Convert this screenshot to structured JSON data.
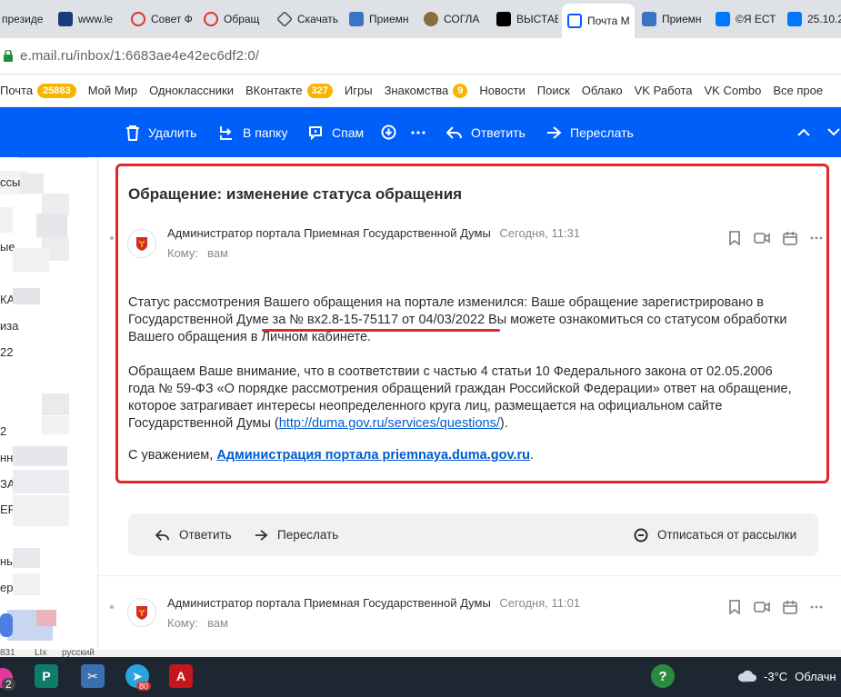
{
  "browser": {
    "tabs": [
      {
        "label": "президе",
        "icon": "kremlin-icon",
        "color": "#c4c7cc"
      },
      {
        "label": "www.le",
        "icon": "emblem-icon",
        "color": "#1a3a7a"
      },
      {
        "label": "Совет Ф",
        "icon": "council-icon",
        "color": "#d33"
      },
      {
        "label": "Обращ",
        "icon": "council-icon",
        "color": "#d33"
      },
      {
        "label": "Скачать",
        "icon": "cube-icon",
        "color": "#555"
      },
      {
        "label": "Приемн",
        "icon": "duma-icon",
        "color": "#3a75c4"
      },
      {
        "label": "СОГЛА",
        "icon": "emblem-round-icon",
        "color": "#8a6d3b"
      },
      {
        "label": "ВЫСТАВ",
        "icon": "tiktok-icon",
        "color": "#000"
      },
      {
        "label": "Почта М",
        "icon": "mail-icon",
        "color": "#005ff9"
      },
      {
        "label": "Приемн",
        "icon": "duma-icon",
        "color": "#3a75c4"
      },
      {
        "label": "©Я ЕСТ",
        "icon": "vk-icon",
        "color": "#0077ff"
      },
      {
        "label": "25.10.2",
        "icon": "vk-icon",
        "color": "#0077ff"
      }
    ],
    "url": "e.mail.ru/inbox/1:6683ae4e42ec6df2:0/"
  },
  "portal": {
    "items": [
      {
        "label": "Почта",
        "badge": "25883"
      },
      {
        "label": "Мой Мир"
      },
      {
        "label": "Одноклассники"
      },
      {
        "label": "ВКонтакте",
        "badge": "327"
      },
      {
        "label": "Игры"
      },
      {
        "label": "Знакомства",
        "badge": "9"
      },
      {
        "label": "Новости"
      },
      {
        "label": "Поиск"
      },
      {
        "label": "Облако"
      },
      {
        "label": "VK Работа"
      },
      {
        "label": "VK Combo"
      },
      {
        "label": "Все прое"
      }
    ]
  },
  "toolbar": {
    "delete": "Удалить",
    "move": "В папку",
    "spam": "Спам",
    "reply": "Ответить",
    "forward": "Переслать"
  },
  "sidebar": {
    "fragments": [
      "ссыл",
      "ые",
      "КА",
      "иза",
      "22",
      "2",
      "нн",
      "ЗА",
      "ЕРІ",
      "нь",
      "ерг"
    ]
  },
  "message": {
    "subject": "Обращение: изменение статуса обращения",
    "sender": "Администратор портала Приемная Государственной Думы",
    "time": "Сегодня, 11:31",
    "to_label": "Кому:",
    "to_value": "вам",
    "p1_a": "Статус рассмотрения Вашего обращения на портале изменился: Ваше обращение зарегистрировано в",
    "p1_b": "Государственной Думе за № вх2.8-15-75117 от 04/03/2022 Вы можете ознакомиться со статусом обработки",
    "p1_c": "Вашего обращения в Личном кабинете.",
    "p2_a": "Обращаем Ваше внимание, что в соответствии с частью 4 статьи 10 Федерального закона от 02.05.2006",
    "p2_b": "года № 59-ФЗ «О порядке рассмотрения обращений граждан Российской Федерации» ответ на обращение,",
    "p2_c": "которое затрагивает интересы неопределенного круга лиц, размещается на официальном сайте",
    "p2_d_pre": "Государственной Думы (",
    "p2_link": "http://duma.gov.ru/services/questions/",
    "p2_d_post": ").",
    "sign_pre": "С уважением, ",
    "sign_link": "Администрация портала priemnaya.duma.gov.ru",
    "sign_post": "."
  },
  "actions": {
    "reply": "Ответить",
    "forward": "Переслать",
    "unsubscribe": "Отписаться от рассылки"
  },
  "message2": {
    "sender": "Администратор портала Приемная Государственной Думы",
    "time": "Сегодня, 11:01",
    "to_label": "Кому:",
    "to_value": "вам"
  },
  "statusline": {
    "left": "831",
    "mid": "LIx",
    "lang": "русский"
  },
  "taskbar": {
    "badge_left": "2",
    "telegram_badge": "80",
    "temperature": "-3°C",
    "weather": "Облачн"
  }
}
